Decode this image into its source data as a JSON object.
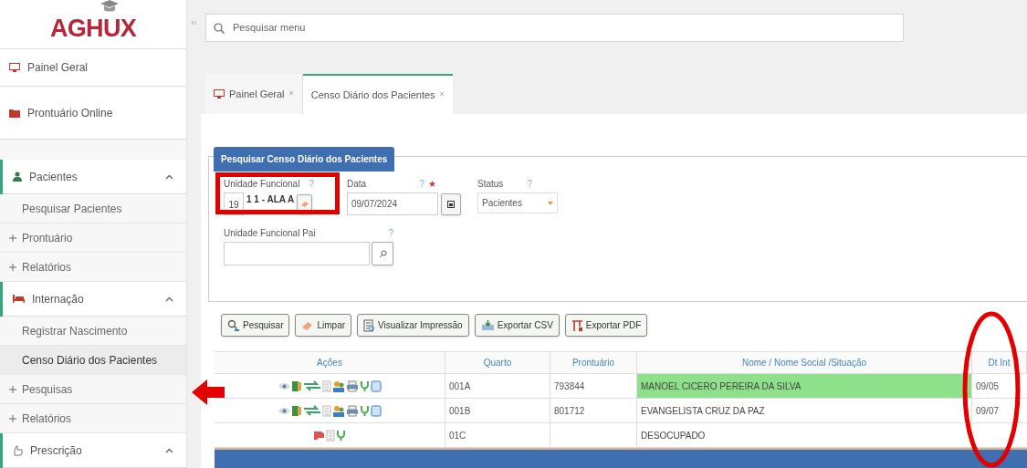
{
  "logo": {
    "text": "AGHUX"
  },
  "search": {
    "placeholder": "Pesquisar menu"
  },
  "sidebar": {
    "items": [
      {
        "kind": "link",
        "label": "Painel Geral"
      },
      {
        "kind": "link",
        "label": "Prontuário Online"
      },
      {
        "kind": "section",
        "label": "Pacientes",
        "expanded": true,
        "children": [
          {
            "kind": "sub",
            "label": "Pesquisar Pacientes",
            "selected": false
          },
          {
            "kind": "plus",
            "label": "Prontuário",
            "selected": false
          },
          {
            "kind": "plus",
            "label": "Relatórios",
            "selected": false
          }
        ]
      },
      {
        "kind": "section",
        "label": "Internação",
        "expanded": true,
        "children": [
          {
            "kind": "sub",
            "label": "Registrar Nascimento",
            "selected": false
          },
          {
            "kind": "sub",
            "label": "Censo Diário dos Pacientes",
            "selected": true
          },
          {
            "kind": "plus",
            "label": "Pesquisas",
            "selected": false
          },
          {
            "kind": "plus",
            "label": "Relatórios",
            "selected": false
          }
        ]
      },
      {
        "kind": "section",
        "label": "Prescrição",
        "expanded": true
      }
    ]
  },
  "tabs": [
    {
      "label": "Painel Geral",
      "close": "×",
      "selected": false
    },
    {
      "label": "Censo Diário dos Pacientes",
      "close": "×",
      "selected": true
    }
  ],
  "form": {
    "title": "Pesquisar Censo Diário dos Pacientes",
    "unidade": {
      "label": "Unidade Funcional",
      "help": "?",
      "code": "19",
      "value": "1 1 - ALA A"
    },
    "data": {
      "label": "Data",
      "help": "?",
      "required_mark": "★",
      "value": "09/07/2024"
    },
    "status": {
      "label": "Status",
      "help": "?",
      "value": "Pacientes"
    },
    "pai": {
      "label": "Unidade Funcional Pai",
      "help": "?"
    }
  },
  "buttons": [
    {
      "label": "Pesquisar"
    },
    {
      "label": "Limpar"
    },
    {
      "label": "Visualizar Impressão"
    },
    {
      "label": "Exportar CSV"
    },
    {
      "label": "Exportar PDF"
    }
  ],
  "table": {
    "columns": [
      "Ações",
      "Quarto",
      "Prontuário",
      "Nome / Nome Social /Situação",
      "Dt Int"
    ],
    "rows": [
      {
        "kind": "occupied",
        "quarto": "001A",
        "prontuario": "793844",
        "nome": "MANOEL CICERO PEREIRA DA SILVA",
        "dt_int": "09/05",
        "highlighted": true
      },
      {
        "kind": "occupied",
        "quarto": "001B",
        "prontuario": "801712",
        "nome": "EVANGELISTA CRUZ DA PAZ",
        "dt_int": "09/07",
        "highlighted": false
      },
      {
        "kind": "vacant",
        "quarto": "01C",
        "nome": "DESOCUPADO",
        "highlighted": false
      }
    ]
  },
  "annotations": [
    {
      "kind": "box"
    },
    {
      "kind": "arrow"
    },
    {
      "kind": "ellipse"
    }
  ]
}
